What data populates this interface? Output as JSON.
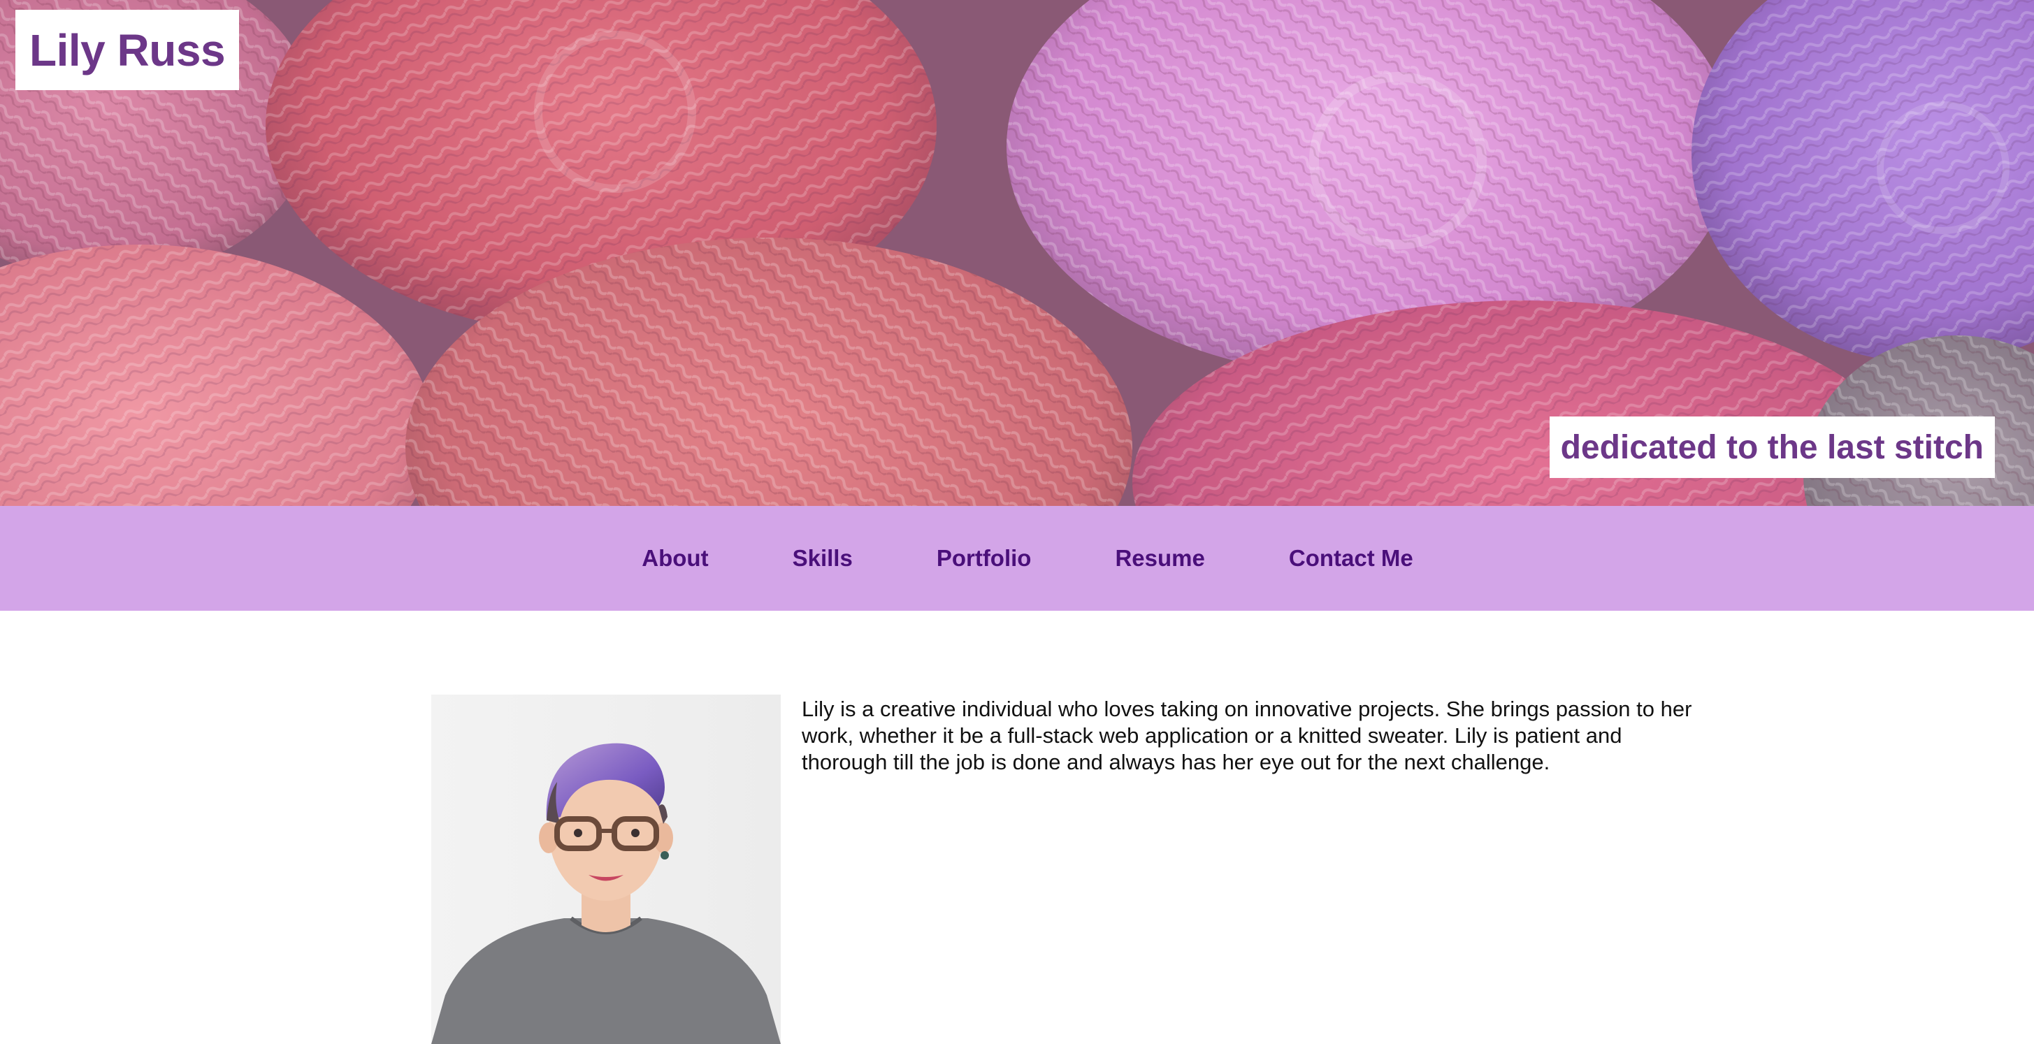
{
  "header": {
    "site_title": "Lily Russ",
    "tagline": "dedicated to the last stitch",
    "background": "yarn-balls-image",
    "title_color": "#6c3788"
  },
  "nav": {
    "background_color": "#d3a5e8",
    "text_color": "#4a0f7a",
    "items": [
      {
        "label": "About"
      },
      {
        "label": "Skills"
      },
      {
        "label": "Portfolio"
      },
      {
        "label": "Resume"
      },
      {
        "label": "Contact Me"
      }
    ]
  },
  "about": {
    "portrait": "portrait-photo",
    "bio": "Lily is a creative individual who loves taking on innovative projects. She brings passion to her work, whether it be a full-stack web application or a knitted sweater. Lily is patient and thorough till the job is done and always has her eye out for the next challenge."
  }
}
